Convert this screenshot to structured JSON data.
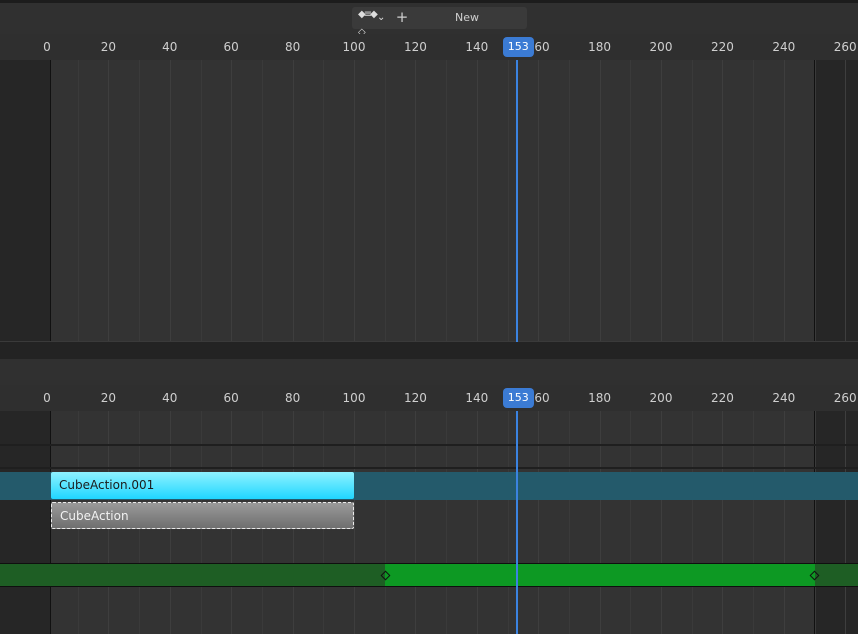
{
  "header": {
    "action_type_icon": "keyframe-type-icon",
    "new_button_label": "New"
  },
  "timeline": {
    "ticks": [
      "0",
      "20",
      "40",
      "60",
      "80",
      "100",
      "120",
      "140",
      "160",
      "180",
      "200",
      "220",
      "240",
      "260"
    ],
    "current_frame": "153",
    "playhead_color": "#3b83e0"
  },
  "nla": {
    "strips": [
      {
        "name": "CubeAction.001",
        "state": "active",
        "color": "#20d6ff"
      },
      {
        "name": "CubeAction",
        "state": "selected",
        "color": "#7a7a7a"
      }
    ],
    "sound_strip_color": "#0d9923"
  }
}
